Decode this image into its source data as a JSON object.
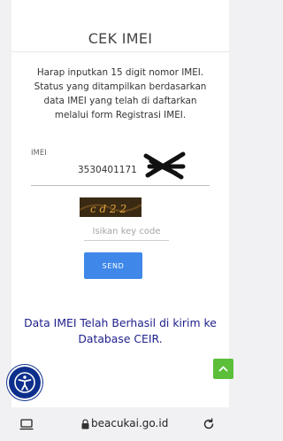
{
  "page": {
    "title": "CEK IMEI",
    "description": "Harap inputkan 15 digit nomor IMEI. Status yang ditampilkan berdasarkan data IMEI yang telah di daftarkan melalui form Registrasi IMEI."
  },
  "imei": {
    "label": "IMEI",
    "value": "3530401171"
  },
  "captcha": {
    "text": "c d 2 2"
  },
  "key_input": {
    "placeholder": "Isikan key code"
  },
  "send_button": {
    "label": "SEND"
  },
  "result": {
    "message": "Data IMEI Telah Berhasil di kirim ke Database CEIR."
  },
  "browser": {
    "domain": "beacukai.go.id"
  },
  "colors": {
    "send_button": "#3f88e9",
    "success_text": "#1c1f8a",
    "scroll_top": "#5cbf3a",
    "accessibility": "#0d2f8c"
  }
}
